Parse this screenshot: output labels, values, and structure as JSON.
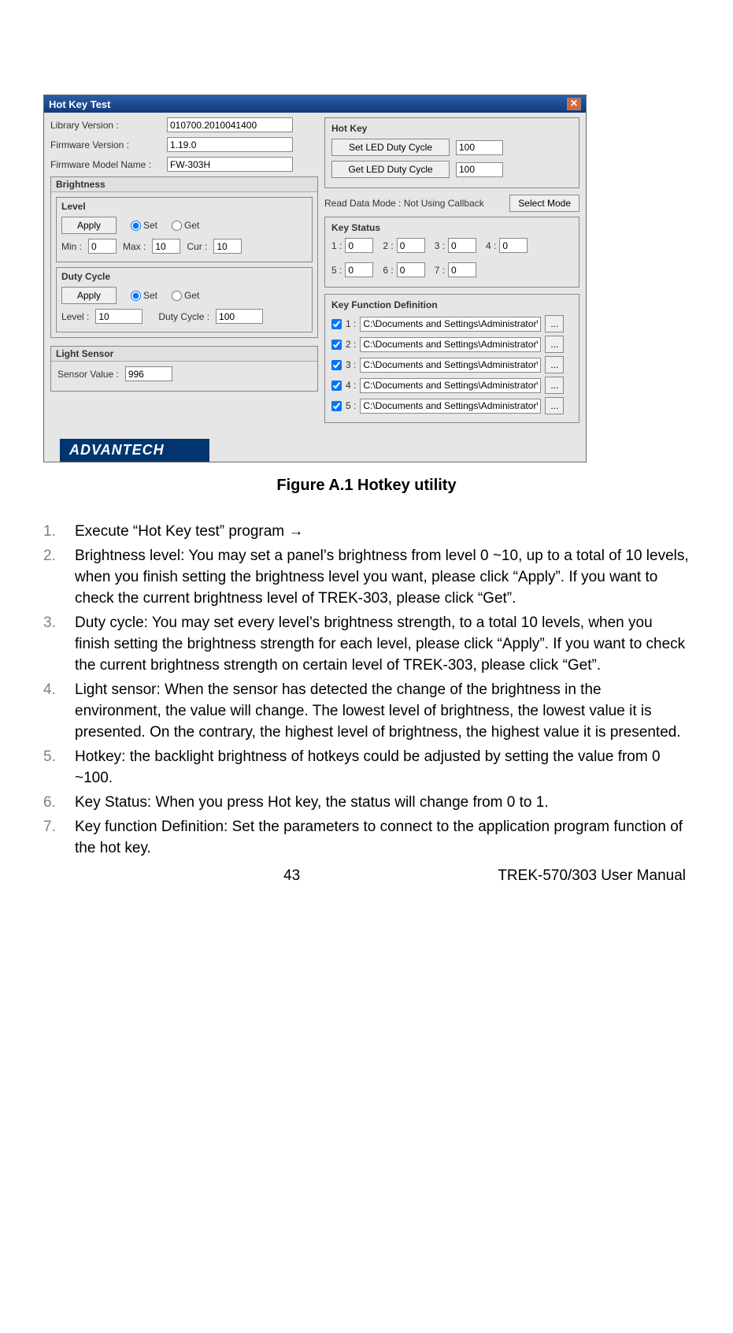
{
  "dialog": {
    "title": "Hot Key Test",
    "close_glyph": "✕",
    "fields": {
      "library_version_label": "Library Version :",
      "library_version_value": "010700.2010041400",
      "firmware_version_label": "Firmware Version :",
      "firmware_version_value": "1.19.0",
      "firmware_model_label": "Firmware Model Name :",
      "firmware_model_value": "FW-303H"
    },
    "brightness": {
      "title": "Brightness",
      "level_title": "Level",
      "apply_label": "Apply",
      "set_label": "Set",
      "get_label": "Get",
      "min_label": "Min :",
      "min_value": "0",
      "max_label": "Max :",
      "max_value": "10",
      "cur_label": "Cur :",
      "cur_value": "10",
      "duty_title": "Duty Cycle",
      "level2_label": "Level :",
      "level2_value": "10",
      "dutycycle_label": "Duty Cycle :",
      "dutycycle_value": "100"
    },
    "light_sensor": {
      "title": "Light Sensor",
      "sensor_label": "Sensor Value :",
      "sensor_value": "996"
    },
    "hotkey": {
      "title": "Hot Key",
      "set_led_label": "Set LED Duty Cycle",
      "set_led_value": "100",
      "get_led_label": "Get LED Duty Cycle",
      "get_led_value": "100",
      "read_mode_text": "Read Data Mode : Not Using Callback",
      "select_mode_label": "Select Mode"
    },
    "key_status": {
      "title": "Key Status",
      "items": [
        {
          "label": "1 :",
          "value": "0"
        },
        {
          "label": "2 :",
          "value": "0"
        },
        {
          "label": "3 :",
          "value": "0"
        },
        {
          "label": "4 :",
          "value": "0"
        },
        {
          "label": "5 :",
          "value": "0"
        },
        {
          "label": "6 :",
          "value": "0"
        },
        {
          "label": "7 :",
          "value": "0"
        }
      ]
    },
    "key_function": {
      "title": "Key Function Definition",
      "rows": [
        {
          "label": "1 :",
          "path": "C:\\Documents and Settings\\Administrator\\Des"
        },
        {
          "label": "2 :",
          "path": "C:\\Documents and Settings\\Administrator\\Des"
        },
        {
          "label": "3 :",
          "path": "C:\\Documents and Settings\\Administrator\\Des"
        },
        {
          "label": "4 :",
          "path": "C:\\Documents and Settings\\Administrator\\Des"
        },
        {
          "label": "5 :",
          "path": "C:\\Documents and Settings\\Administrator\\Des"
        }
      ],
      "browse_label": "..."
    },
    "brand": "ADVANTECH"
  },
  "figure_caption": "Figure A.1 Hotkey utility",
  "steps": [
    "Execute “Hot Key test” program →",
    "Brightness level: You may set a panel’s brightness from level 0 ~10, up to a total of 10 levels, when you finish setting the brightness level you want, please click “Apply”. If you want to check the current brightness level of TREK-303, please click “Get”.",
    "Duty cycle: You may set every level’s brightness strength, to a total 10 levels, when you finish setting the brightness strength for each level, please click “Apply”. If you want to check the current brightness strength on certain level of TREK-303, please click “Get”.",
    "Light sensor: When the sensor has detected the change of the brightness in the environment, the value will change. The lowest level of brightness, the lowest value it is presented. On the contrary, the highest level of brightness, the highest value it is presented.",
    "Hotkey: the backlight brightness of hotkeys could be adjusted by setting the value from 0 ~100.",
    "Key Status: When you press Hot key, the status will change from 0 to 1.",
    "Key function Definition: Set the parameters to connect to the application program function of the hot key."
  ],
  "footer": {
    "page_number": "43",
    "doc_title": "TREK-570/303 User Manual"
  }
}
